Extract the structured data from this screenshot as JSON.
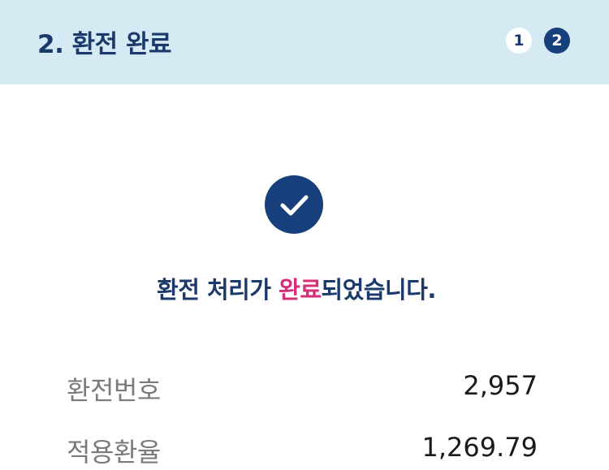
{
  "header": {
    "title": "2. 환전 완료",
    "steps": [
      "1",
      "2"
    ],
    "active_step": 2
  },
  "status": {
    "icon": "check-icon",
    "message_prefix": "환전 처리가 ",
    "message_highlight": "완료",
    "message_suffix": "되었습니다."
  },
  "details": {
    "exchange_number_label": "환전번호",
    "exchange_number_value": "2,957",
    "applied_rate_label": "적용환율",
    "applied_rate_value": "1,269.79"
  },
  "colors": {
    "header_bg": "#d6eaf4",
    "primary": "#173f7c",
    "highlight": "#d62f79",
    "label": "#7a7a7a"
  }
}
